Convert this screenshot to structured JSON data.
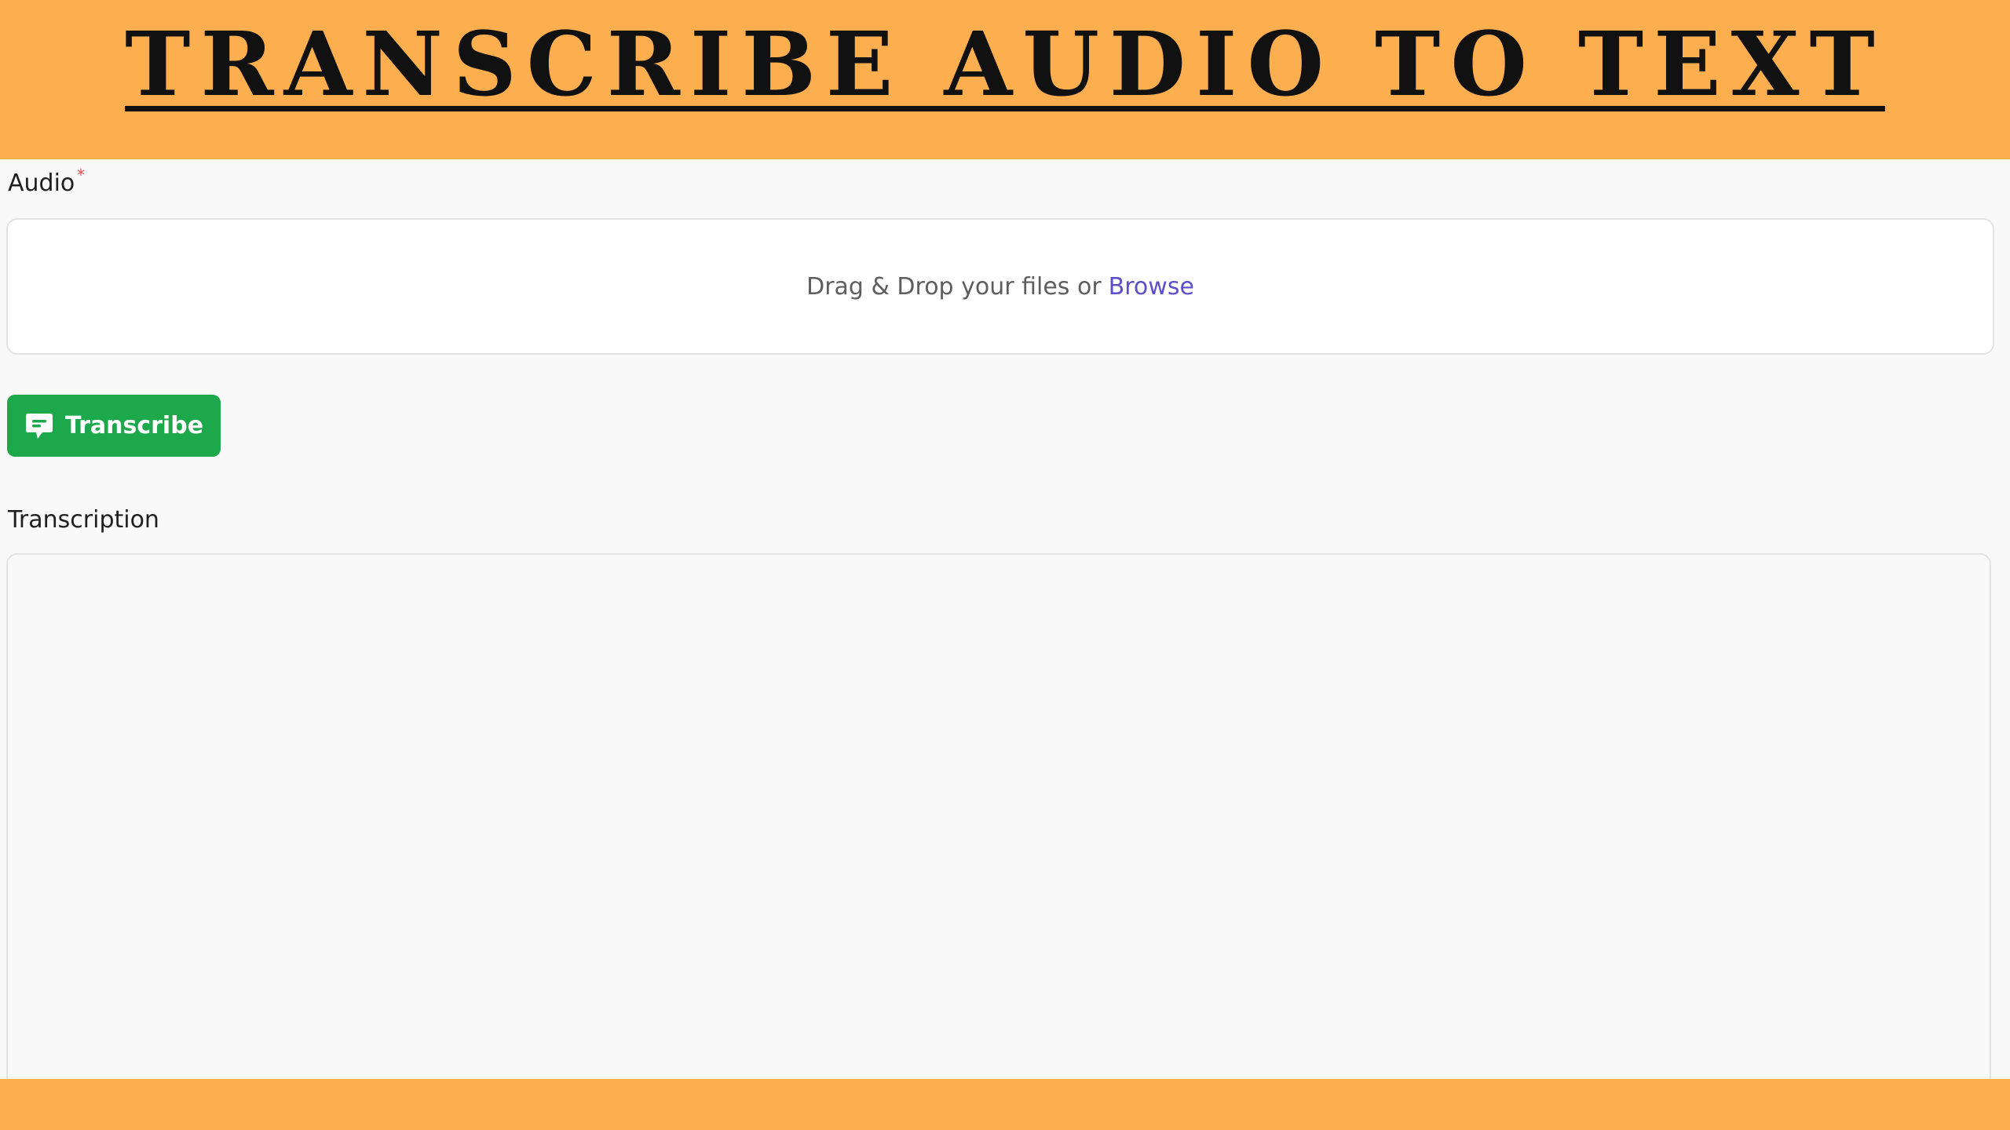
{
  "header": {
    "title": "TRANSCRIBE AUDIO TO TEXT"
  },
  "audio_field": {
    "label": "Audio",
    "required_mark": "*",
    "dropzone_text": "Drag & Drop your files or",
    "browse_link": "Browse"
  },
  "transcribe_button": {
    "label": "Transcribe",
    "icon": "chat-bubble-icon"
  },
  "transcription_field": {
    "label": "Transcription",
    "value": ""
  },
  "colors": {
    "banner": "#fdae4f",
    "button": "#1ea84c",
    "link": "#5b50c9",
    "required": "#e5484d"
  }
}
